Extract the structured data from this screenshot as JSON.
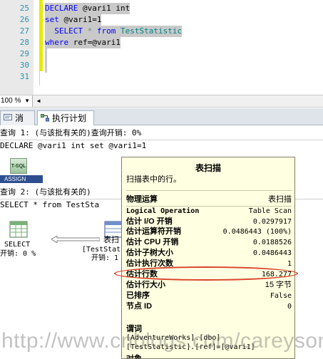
{
  "editor": {
    "line_numbers": [
      "25",
      "26",
      "27",
      "28",
      "29",
      "30",
      "31"
    ],
    "code": {
      "l25_kw": "DECLARE",
      "l25_rest": " @vari1 int",
      "l26_kw": "set",
      "l26_rest": " @vari1=1",
      "l27_lead": "  ",
      "l27_kw1": "SELECT",
      "l27_star": " * ",
      "l27_kw2": "from",
      "l27_obj": " TestStatistic",
      "l28_kw": "where",
      "l28_rest": " ref=@vari1"
    }
  },
  "scroll": {
    "zoom": "100 %"
  },
  "tabs": [
    {
      "label": "消息",
      "icon": "messages-icon"
    },
    {
      "label": "执行计划",
      "icon": "execution-plan-icon"
    }
  ],
  "results": {
    "query1_header": "查询 1: (与该批有关的)查询开销: 0%",
    "query1_text": "DECLARE @vari1 int set @vari1=1",
    "tsql_label": "T-SQL",
    "assign_label": "ASSIGN",
    "query2_header": "查询 2: (与该批有关的)",
    "query2_text": "SELECT * from TestSta",
    "select_node": {
      "label": "SELECT",
      "cost": "开销: 0 %"
    },
    "scan_node": {
      "label": "表扫",
      "object": "[TestStat",
      "cost": "开销: 1"
    }
  },
  "tooltip": {
    "title": "表扫描",
    "description": "扫描表中的行。",
    "rows": [
      {
        "key": "物理运算",
        "value": "表扫描"
      },
      {
        "key": "Logical Operation",
        "value": "Table Scan"
      },
      {
        "key": "估计 I/O 开销",
        "value": "0.0297917"
      },
      {
        "key": "估计运算符开销",
        "value": "0.0486443 (100%)"
      },
      {
        "key": "估计 CPU 开销",
        "value": "0.0188526"
      },
      {
        "key": "估计子树大小",
        "value": "0.0486443"
      },
      {
        "key": "估计执行次数",
        "value": "1"
      },
      {
        "key": "估计行数",
        "value": "168.277"
      },
      {
        "key": "估计行大小",
        "value": "15 字节"
      },
      {
        "key": "已排序",
        "value": "False"
      },
      {
        "key": "节点 ID",
        "value": "0"
      }
    ],
    "object_heading": "谓词",
    "object_line1": "[AdventureWorks].[dbo]",
    "object_line2": "[TestStatistic].[ref]=[@vari1]",
    "trailing_heading": "对象"
  },
  "watermark": "http://www.cnblogs.com/careyson",
  "colors": {
    "highlight": "#d9432a",
    "tooltip_bg": "#ffffe1",
    "keyword": "#0000ff",
    "object": "#008080"
  }
}
